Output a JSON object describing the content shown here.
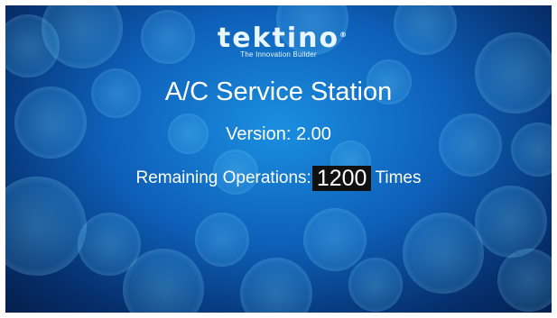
{
  "screen": {
    "brand": {
      "logo_text": "tektino",
      "registered_mark": "®",
      "tagline": "The Innovation Builder"
    },
    "title": "A/C Service Station",
    "version": "Version: 2.00",
    "remaining": {
      "label": "Remaining Operations:",
      "count": "1200",
      "unit": "Times"
    },
    "colors": {
      "background_center": "#1a8fe0",
      "background_edge": "#041f4d",
      "count_box": "#101010",
      "text": "#ffffff"
    }
  }
}
